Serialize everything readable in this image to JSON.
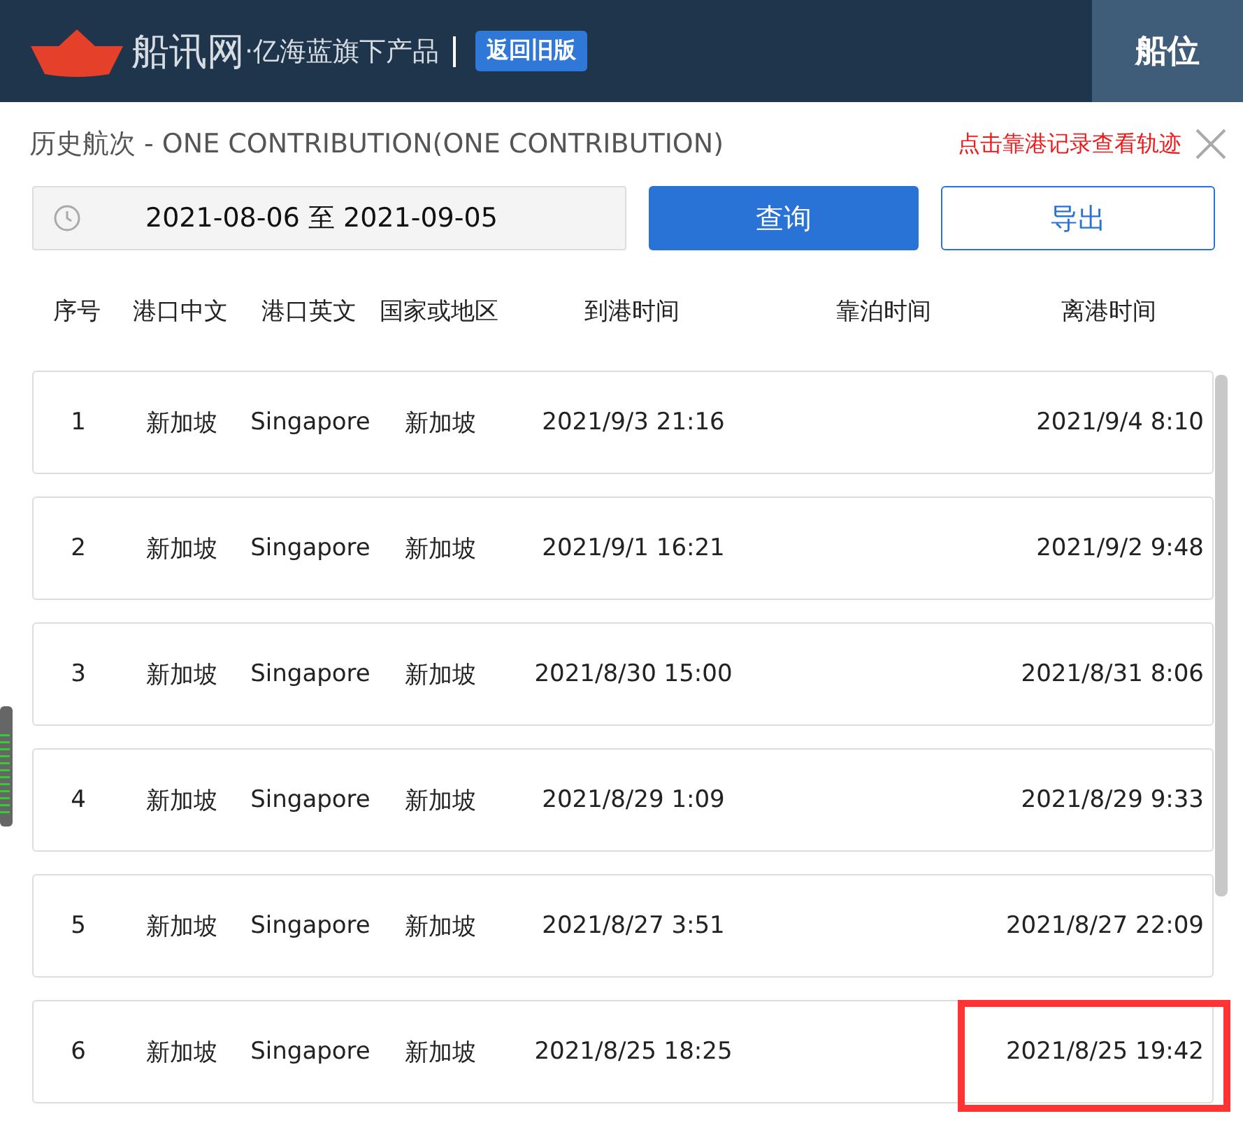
{
  "header": {
    "brand": "船讯网",
    "tagline": "·亿海蓝旗下产品",
    "old_version_button": "返回旧版",
    "tab": "船位"
  },
  "panel": {
    "title": "历史航次 - ONE CONTRIBUTION(ONE CONTRIBUTION)",
    "hint": "点击靠港记录查看轨迹",
    "date_range": "2021-08-06 至 2021-09-05",
    "query_button": "查询",
    "export_button": "导出"
  },
  "table": {
    "columns": [
      "序号",
      "港口中文",
      "港口英文",
      "国家或地区",
      "到港时间",
      "靠泊时间",
      "离港时间"
    ],
    "rows": [
      {
        "index": "1",
        "port_cn": "新加坡",
        "port_en": "Singapore",
        "country": "新加坡",
        "arrival": "2021/9/3 21:16",
        "departure": "2021/9/4 8:10",
        "highlighted": false
      },
      {
        "index": "2",
        "port_cn": "新加坡",
        "port_en": "Singapore",
        "country": "新加坡",
        "arrival": "2021/9/1 16:21",
        "departure": "2021/9/2 9:48",
        "highlighted": false
      },
      {
        "index": "3",
        "port_cn": "新加坡",
        "port_en": "Singapore",
        "country": "新加坡",
        "arrival": "2021/8/30 15:00",
        "departure": "2021/8/31 8:06",
        "highlighted": false
      },
      {
        "index": "4",
        "port_cn": "新加坡",
        "port_en": "Singapore",
        "country": "新加坡",
        "arrival": "2021/8/29 1:09",
        "departure": "2021/8/29 9:33",
        "highlighted": false
      },
      {
        "index": "5",
        "port_cn": "新加坡",
        "port_en": "Singapore",
        "country": "新加坡",
        "arrival": "2021/8/27 3:51",
        "departure": "2021/8/27 22:09",
        "highlighted": false
      },
      {
        "index": "6",
        "port_cn": "新加坡",
        "port_en": "Singapore",
        "country": "新加坡",
        "arrival": "2021/8/25 18:25",
        "departure": "2021/8/25 19:42",
        "highlighted": true
      }
    ]
  }
}
